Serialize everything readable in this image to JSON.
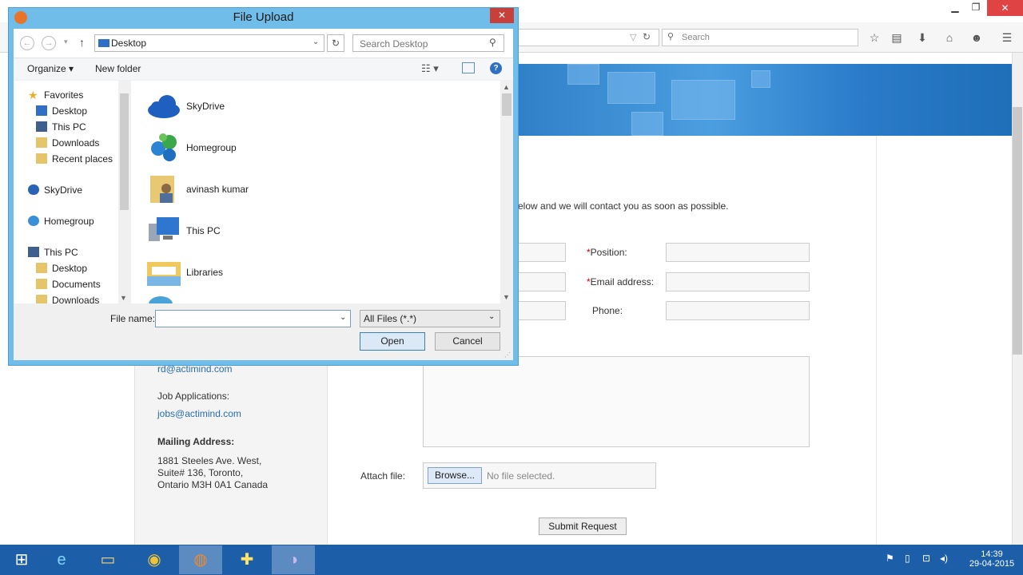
{
  "browser": {
    "search_placeholder": "Search"
  },
  "page": {
    "intro_text": "elow and we will contact you as soon as possible.",
    "position_label": "Position:",
    "email_label": "Email address:",
    "phone_label": "Phone:",
    "required_mark": "*",
    "rd_email": "rd@actimind.com",
    "job_app_label": "Job Applications:",
    "jobs_email": "jobs@actimind.com",
    "mailing_heading": "Mailing Address:",
    "address_line1": "1881 Steeles Ave. West,",
    "address_line2": "Suite# 136, Toronto,",
    "address_line3": "Ontario M3H 0A1 Canada",
    "attach_label": "Attach file:",
    "browse_label": "Browse...",
    "no_file_text": "No file selected.",
    "submit_label": "Submit Request"
  },
  "dialog": {
    "title": "File Upload",
    "close_glyph": "✕",
    "address_value": "Desktop",
    "search_placeholder": "Search Desktop",
    "organize_label": "Organize ▾",
    "new_folder_label": "New folder",
    "nav_items": [
      {
        "label": "Favorites",
        "icon": "star-icon"
      },
      {
        "label": "Desktop",
        "icon": "desktop-icon"
      },
      {
        "label": "This PC",
        "icon": "computer-icon"
      },
      {
        "label": "Downloads",
        "icon": "downloads-folder-icon"
      },
      {
        "label": "Recent places",
        "icon": "recent-places-icon"
      },
      {
        "label": "SkyDrive",
        "icon": "skydrive-icon"
      },
      {
        "label": "Homegroup",
        "icon": "homegroup-icon"
      },
      {
        "label": "This PC",
        "icon": "computer-icon"
      },
      {
        "label": "Desktop",
        "icon": "folder-icon"
      },
      {
        "label": "Documents",
        "icon": "folder-icon"
      },
      {
        "label": "Downloads",
        "icon": "downloads-folder-icon"
      }
    ],
    "content_items": [
      {
        "label": "SkyDrive",
        "icon": "skydrive-icon"
      },
      {
        "label": "Homegroup",
        "icon": "homegroup-icon"
      },
      {
        "label": "avinash kumar",
        "icon": "user-folder-icon"
      },
      {
        "label": "This PC",
        "icon": "computer-icon"
      },
      {
        "label": "Libraries",
        "icon": "libraries-icon"
      }
    ],
    "file_name_label": "File name:",
    "file_name_value": "",
    "file_type_value": "All Files (*.*)",
    "open_label": "Open",
    "cancel_label": "Cancel"
  },
  "taskbar": {
    "clock_time": "14:39",
    "clock_date": "29-04-2015",
    "apps": [
      "windows-start-icon",
      "internet-explorer-icon",
      "file-explorer-icon",
      "chrome-icon",
      "firefox-icon",
      "installer-icon",
      "eclipse-icon"
    ]
  },
  "colors": {
    "dialog_frame": "#6fbde8",
    "taskbar": "#1c5fa8",
    "banner": "#2f7fc7",
    "link": "#2a6db0",
    "close_red": "#c7413a"
  }
}
